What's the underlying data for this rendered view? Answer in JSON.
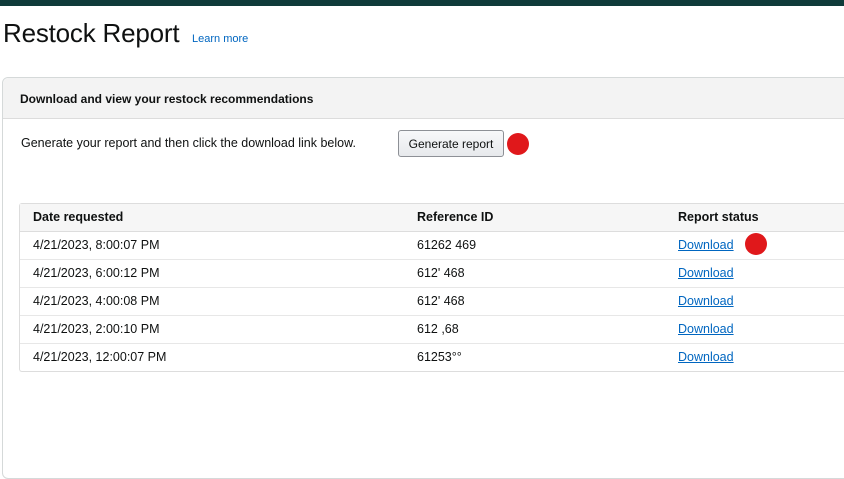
{
  "header": {
    "title": "Restock Report",
    "learn_more": "Learn more"
  },
  "panel": {
    "heading": "Download and view your restock recommendations",
    "instructions": "Generate your report and then click the download link below.",
    "generate_button": "Generate report"
  },
  "table": {
    "columns": [
      "Date requested",
      "Reference ID",
      "Report status"
    ],
    "rows": [
      {
        "date": "4/21/2023, 8:00:07 PM",
        "reference_id": "61262      469",
        "status": "Download"
      },
      {
        "date": "4/21/2023, 6:00:12 PM",
        "reference_id": "612'        468",
        "status": "Download"
      },
      {
        "date": "4/21/2023, 4:00:08 PM",
        "reference_id": "612'        468",
        "status": "Download"
      },
      {
        "date": "4/21/2023, 2:00:10 PM",
        "reference_id": "612          ,68",
        "status": "Download"
      },
      {
        "date": "4/21/2023, 12:00:07 PM",
        "reference_id": "61253°°",
        "status": "Download"
      }
    ]
  },
  "colors": {
    "top_bar": "#0f3b3a",
    "link": "#0066c0",
    "annotation_marker": "#e0181b"
  }
}
